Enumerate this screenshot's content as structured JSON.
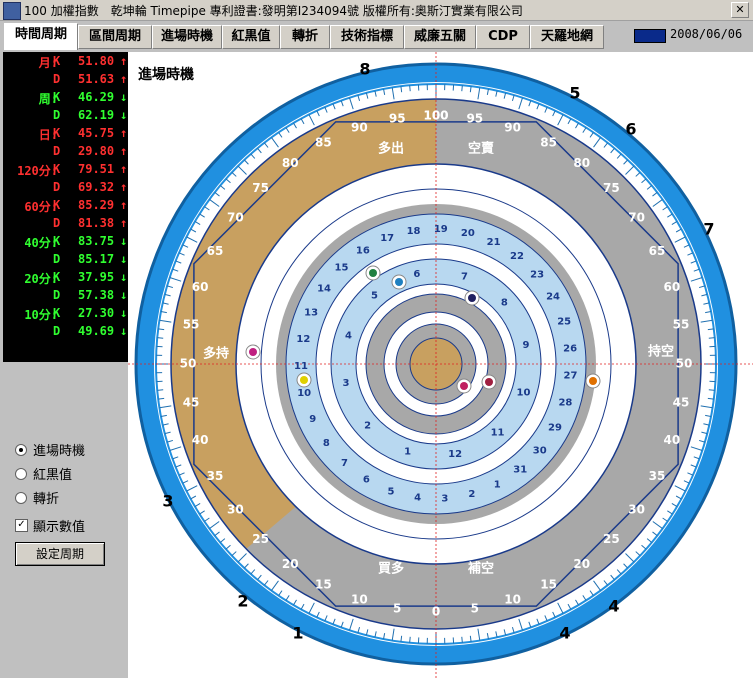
{
  "window": {
    "title": "100 加權指數　乾坤輪 Timepipe 專利證書:發明第I234094號 版權所有:奧斯汀實業有限公司",
    "close_label": "✕"
  },
  "tabs": [
    {
      "label": "時間周期"
    },
    {
      "label": "區間周期"
    },
    {
      "label": "進場時機"
    },
    {
      "label": "紅黒值"
    },
    {
      "label": "轉折"
    },
    {
      "label": "技術指標"
    },
    {
      "label": "威廉五關"
    },
    {
      "label": "CDP"
    },
    {
      "label": "天羅地網"
    }
  ],
  "date": "2008/06/06",
  "indicators": [
    {
      "label": "月:",
      "k": "51.80",
      "d": "51.63",
      "k_arrow": "↑",
      "d_arrow": "↑",
      "color": "#ff3030"
    },
    {
      "label": "周:",
      "k": "46.29",
      "d": "62.19",
      "k_arrow": "↓",
      "d_arrow": "↓",
      "color": "#30ff30"
    },
    {
      "label": "日:",
      "k": "45.75",
      "d": "29.80",
      "k_arrow": "↑",
      "d_arrow": "↑",
      "color": "#ff3030"
    },
    {
      "label": "120分:",
      "k": "79.51",
      "d": "69.32",
      "k_arrow": "↑",
      "d_arrow": "↑",
      "color": "#ff3030"
    },
    {
      "label": "60分:",
      "k": "85.29",
      "d": "81.38",
      "k_arrow": "↑",
      "d_arrow": "↑",
      "color": "#ff3030"
    },
    {
      "label": "40分:",
      "k": "83.75",
      "d": "85.17",
      "k_arrow": "↓",
      "d_arrow": "↓",
      "color": "#30ff30"
    },
    {
      "label": "20分:",
      "k": "37.95",
      "d": "57.38",
      "k_arrow": "↓",
      "d_arrow": "↓",
      "color": "#30ff30"
    },
    {
      "label": "10分:",
      "k": "27.30",
      "d": "49.69",
      "k_arrow": "↓",
      "d_arrow": "↓",
      "color": "#30ff30"
    }
  ],
  "controls": {
    "radio_entry": "進場時機",
    "radio_redblack": "紅黒值",
    "radio_turn": "轉折",
    "check_show_values": "顯示數值",
    "check_mark": "✓",
    "set_period_button": "設定周期"
  },
  "chart": {
    "label": "進場時機",
    "outer_numbers": [
      "8",
      "5",
      "6",
      "7",
      "4",
      "4",
      "1",
      "2",
      "3"
    ],
    "quadrant_labels": {
      "top_left": "多出",
      "top_right": "空賣",
      "right": "持空",
      "left": "多持",
      "bottom_left": "買多",
      "bottom_right": "補空"
    },
    "scale_numbers": [
      "100",
      "95",
      "90",
      "85",
      "80",
      "75",
      "70",
      "65",
      "60",
      "55",
      "50",
      "45",
      "40",
      "35",
      "30",
      "25",
      "20",
      "15",
      "10",
      "5",
      "0"
    ],
    "dots": [
      {
        "color": "#c02080",
        "ring": "outer"
      },
      {
        "color": "#e0d000",
        "ring": "outer"
      },
      {
        "color": "#e07000",
        "ring": "outer"
      },
      {
        "color": "#208040",
        "ring": "middle"
      },
      {
        "color": "#2080c0",
        "ring": "middle"
      },
      {
        "color": "#202060",
        "ring": "middle"
      },
      {
        "color": "#c02060",
        "ring": "inner"
      },
      {
        "color": "#a02040",
        "ring": "inner"
      }
    ],
    "colors": {
      "outer_blue": "#1e88d8",
      "tan": "#c8a060",
      "gray": "#a8a8a8",
      "light_blue": "#b8d8f0",
      "navy": "#1a3a8a"
    }
  }
}
